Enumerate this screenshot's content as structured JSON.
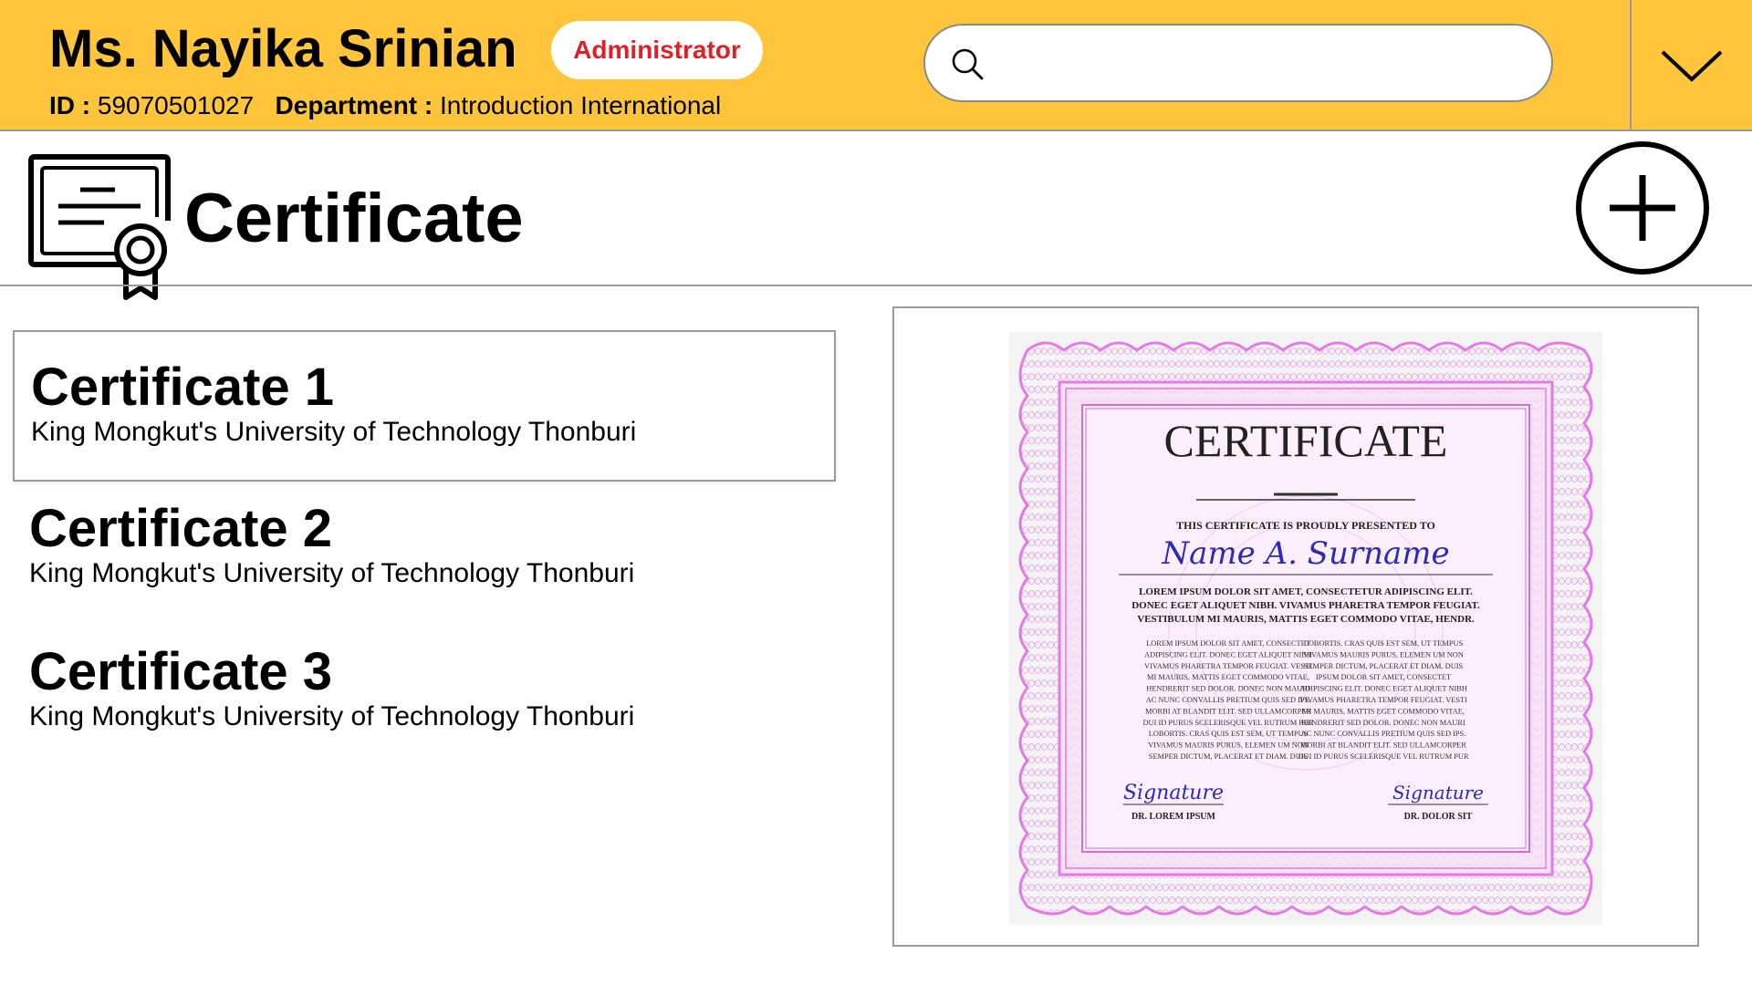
{
  "header": {
    "user_name": "Ms. Nayika Srinian",
    "role_badge": "Administrator",
    "id_label": "ID :",
    "id_value": "59070501027",
    "department_label": "Department :",
    "department_value": "Introduction International",
    "search": {
      "value": "",
      "placeholder": ""
    },
    "menu_toggle_icon": "chevron-down-icon",
    "colors": {
      "background": "#FFC63D",
      "badge_text": "#E01F26"
    }
  },
  "page": {
    "title": "Certificate",
    "title_icon": "certificate-icon",
    "add_icon": "plus-circle-icon"
  },
  "certificates": [
    {
      "title": "Certificate 1",
      "issuer": "King Mongkut's University of Technology Thonburi",
      "selected": true
    },
    {
      "title": "Certificate 2",
      "issuer": "King Mongkut's University of Technology Thonburi",
      "selected": false
    },
    {
      "title": "Certificate 3",
      "issuer": "King Mongkut's University of Technology Thonburi",
      "selected": false
    }
  ],
  "preview": {
    "heading": "CERTIFICATE",
    "presented_to": "THIS CERTIFICATE IS PROUDLY PRESENTED TO",
    "recipient": "Name A. Surname",
    "lead_line_1": "LOREM IPSUM DOLOR SIT AMET, CONSECTETUR ADIPISCING ELIT.",
    "lead_line_2": "DONEC EGET ALIQUET NIBH. VIVAMUS PHARETRA TEMPOR FEUGIAT.",
    "lead_line_3": "VESTIBULUM MI MAURIS, MATTIS EGET COMMODO VITAE, HENDR.",
    "col_left": [
      "LOREM IPSUM DOLOR SIT AMET, CONSECTET",
      "ADIPISCING ELIT. DONEC EGET ALIQUET NIBH",
      "VIVAMUS PHARETRA TEMPOR FEUGIAT. VESTI",
      "MI MAURIS, MATTIS EGET COMMODO VITAE,",
      "HENDRERIT SED DOLOR. DONEC NON MAURI",
      "AC NUNC CONVALLIS PRETIUM QUIS SED IPS.",
      "MORBI AT BLANDIT ELIT. SED ULLAMCORPER",
      "DUI ID PURUS SCELERISQUE VEL RUTRUM PUR",
      "LOBORTIS. CRAS QUIS EST SEM, UT TEMPUS",
      "VIVAMUS MAURIS PURUS, ELEMEN UM NON",
      "SEMPER DICTUM, PLACERAT ET DIAM. DUIS"
    ],
    "col_right": [
      "LOBORTIS. CRAS QUIS EST SEM, UT TEMPUS",
      "VIVAMUS MAURIS PURUS, ELEMEN UM NON",
      "SEMPER DICTUM, PLACERAT ET DIAM. DUIS",
      "IPSUM DOLOR SIT AMET, CONSECTET",
      "ADIPISCING ELIT. DONEC EGET ALIQUET NIBH",
      "VIVAMUS PHARETRA TEMPOR FEUGIAT. VESTI",
      "MI MAURIS, MATTIS EGET COMMODO VITAE,",
      "HENDRERIT SED DOLOR. DONEC NON MAURI",
      "AC NUNC CONVALLIS PRETIUM QUIS SED IPS.",
      "MORBI AT BLANDIT ELIT. SED ULLAMCORPER",
      "DUI ID PURUS SCELERISQUE VEL RUTRUM PUR"
    ],
    "signature_left": "Signature",
    "signer_left": "DR. LOREM IPSUM",
    "signature_right": "Signature",
    "signer_right": "DR. DOLOR SIT",
    "colors": {
      "border": "#E27BE3",
      "fill": "#F4D4F3",
      "ink": "#2B2BB8"
    }
  }
}
